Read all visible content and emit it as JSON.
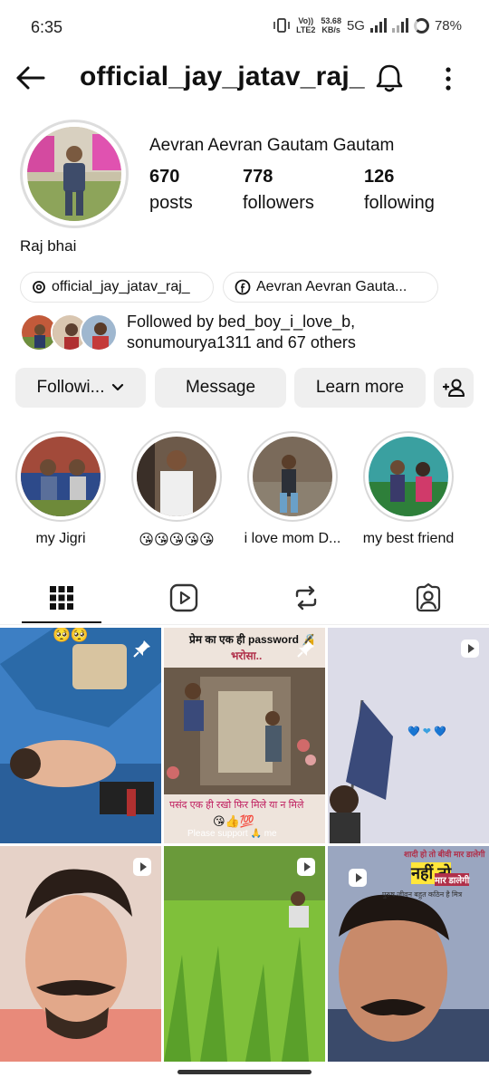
{
  "status_bar": {
    "time": "6:35",
    "network_top": "Vo))",
    "network_bottom": "LTE2",
    "speed_top": "53.68",
    "speed_bottom": "KB/s",
    "network_type": "5G",
    "battery": "78%"
  },
  "header": {
    "username": "official_jay_jatav_raj_",
    "back_icon": "arrow-left-icon",
    "bell_icon": "bell-icon",
    "more_icon": "more-vertical-icon"
  },
  "profile": {
    "full_name": "Aevran Aevran Gautam Gautam",
    "stats": [
      {
        "value": "670",
        "label": "posts"
      },
      {
        "value": "778",
        "label": "followers"
      },
      {
        "value": "126",
        "label": "following"
      }
    ],
    "bio": "Raj bhai",
    "links": [
      {
        "icon": "threads-icon",
        "text": "official_jay_jatav_raj_"
      },
      {
        "icon": "facebook-icon",
        "text": "Aevran Aevran Gauta..."
      }
    ],
    "followed_by_line1": "Followed by bed_boy_i_love_b,",
    "followed_by_line2": "sonumourya1311 and 67 others"
  },
  "actions": {
    "following_label": "Followi...",
    "message_label": "Message",
    "learn_more_label": "Learn more",
    "add_person_icon": "add-person-icon"
  },
  "highlights": [
    {
      "label": "my Jigri"
    },
    {
      "label": "😘😘😘😘😘"
    },
    {
      "label": "i love  mom D..."
    },
    {
      "label": "my best friend"
    }
  ],
  "tabs": [
    {
      "name": "grid-icon",
      "active": true
    },
    {
      "name": "reels-icon",
      "active": false
    },
    {
      "name": "repost-icon",
      "active": false
    },
    {
      "name": "tagged-icon",
      "active": false
    }
  ],
  "posts": [
    {
      "type": "pinned",
      "overlay": "🥺🥺"
    },
    {
      "type": "pinned",
      "overlay_title": "प्रेम का एक ही password 🔏",
      "overlay_sub": "भरोसा..",
      "overlay_bottom": "पसंद एक ही रखो फिर मिले या न मिले",
      "overlay_footer": "Please support 🙏 me",
      "overlay_emoji": "😘👍💯"
    },
    {
      "type": "reel",
      "overlay": "💙 ❤ 💙"
    },
    {
      "type": "reel",
      "overlay": ""
    },
    {
      "type": "reel",
      "overlay": ""
    },
    {
      "type": "reel",
      "overlay_title": "शादी हो तो बीवी मार डालेगी",
      "overlay_sub": "नहीं तो",
      "overlay_bottom": "मार डालेगी",
      "overlay_footer": "पुरुष जीवन बहुत कठिन है मित्र"
    }
  ],
  "colors": {
    "background": "#ffffff",
    "button_bg": "#efefef",
    "text": "#111111"
  }
}
